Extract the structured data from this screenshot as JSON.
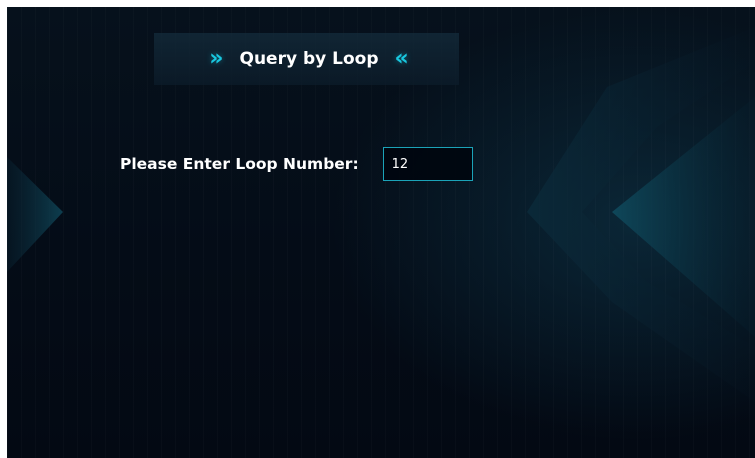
{
  "header": {
    "left_chevron": "»",
    "title": "Query by Loop",
    "right_chevron": "«"
  },
  "form": {
    "label": "Please Enter Loop Number:",
    "loop_value": "12"
  },
  "colors": {
    "background": "#040c17",
    "accent": "#19c8e0",
    "input_border": "#1ba3b8",
    "text": "#ffffff"
  },
  "icons": {
    "left": "double-chevron-right-icon",
    "right": "double-chevron-left-icon"
  }
}
